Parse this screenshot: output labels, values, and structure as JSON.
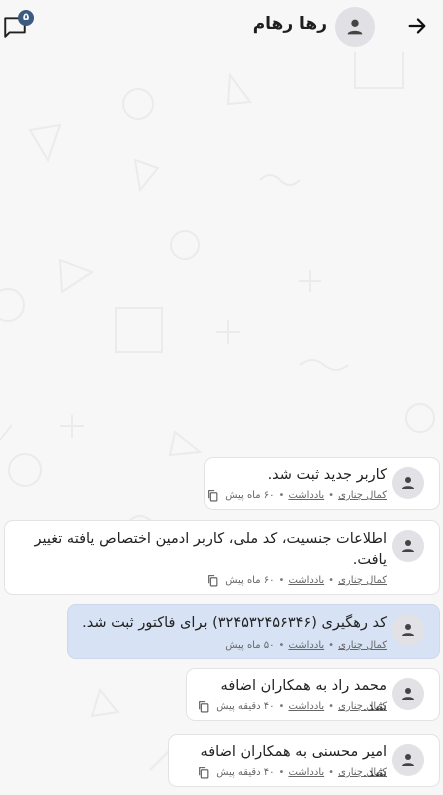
{
  "header": {
    "contact_name": "رها رهام",
    "unread_count": "۵",
    "back_icon": "arrow-right-icon",
    "avatar_icon": "person-icon",
    "chat_icon": "chat-bubble-icon"
  },
  "messages": [
    {
      "text": "کاربر جدید ثبت شد.",
      "author": "کمال چناری",
      "kind": "یادداشت",
      "time": "۶۰ ماه پیش",
      "highlighted": false
    },
    {
      "text": "اطلاعات جنسیت، کد ملی، کاربر ادمین اختصاص یافته تغییر یافت.",
      "author": "کمال چناری",
      "kind": "یادداشت",
      "time": "۶۰ ماه پیش",
      "highlighted": false
    },
    {
      "text": "کد رهگیری (۳۲۴۵۳۲۴۵۶۳۴۶) برای فاکتور ثبت شد.",
      "author": "کمال چناری",
      "kind": "یادداشت",
      "time": "۵۰ ماه پیش",
      "highlighted": true
    },
    {
      "text": "محمد راد به همکاران اضافه شد.",
      "author": "کمال چناری",
      "kind": "یادداشت",
      "time": "۴۰ دقیقه پیش",
      "highlighted": false
    },
    {
      "text": "امیر محسنی به همکاران اضافه شد.",
      "author": "کمال چناری",
      "kind": "یادداشت",
      "time": "۴۰ دقیقه پیش",
      "highlighted": false
    }
  ],
  "colors": {
    "background": "#f7f7f8",
    "bubble": "#ffffff",
    "bubble_highlight": "#d7e2f4",
    "badge": "#3d5a80"
  }
}
